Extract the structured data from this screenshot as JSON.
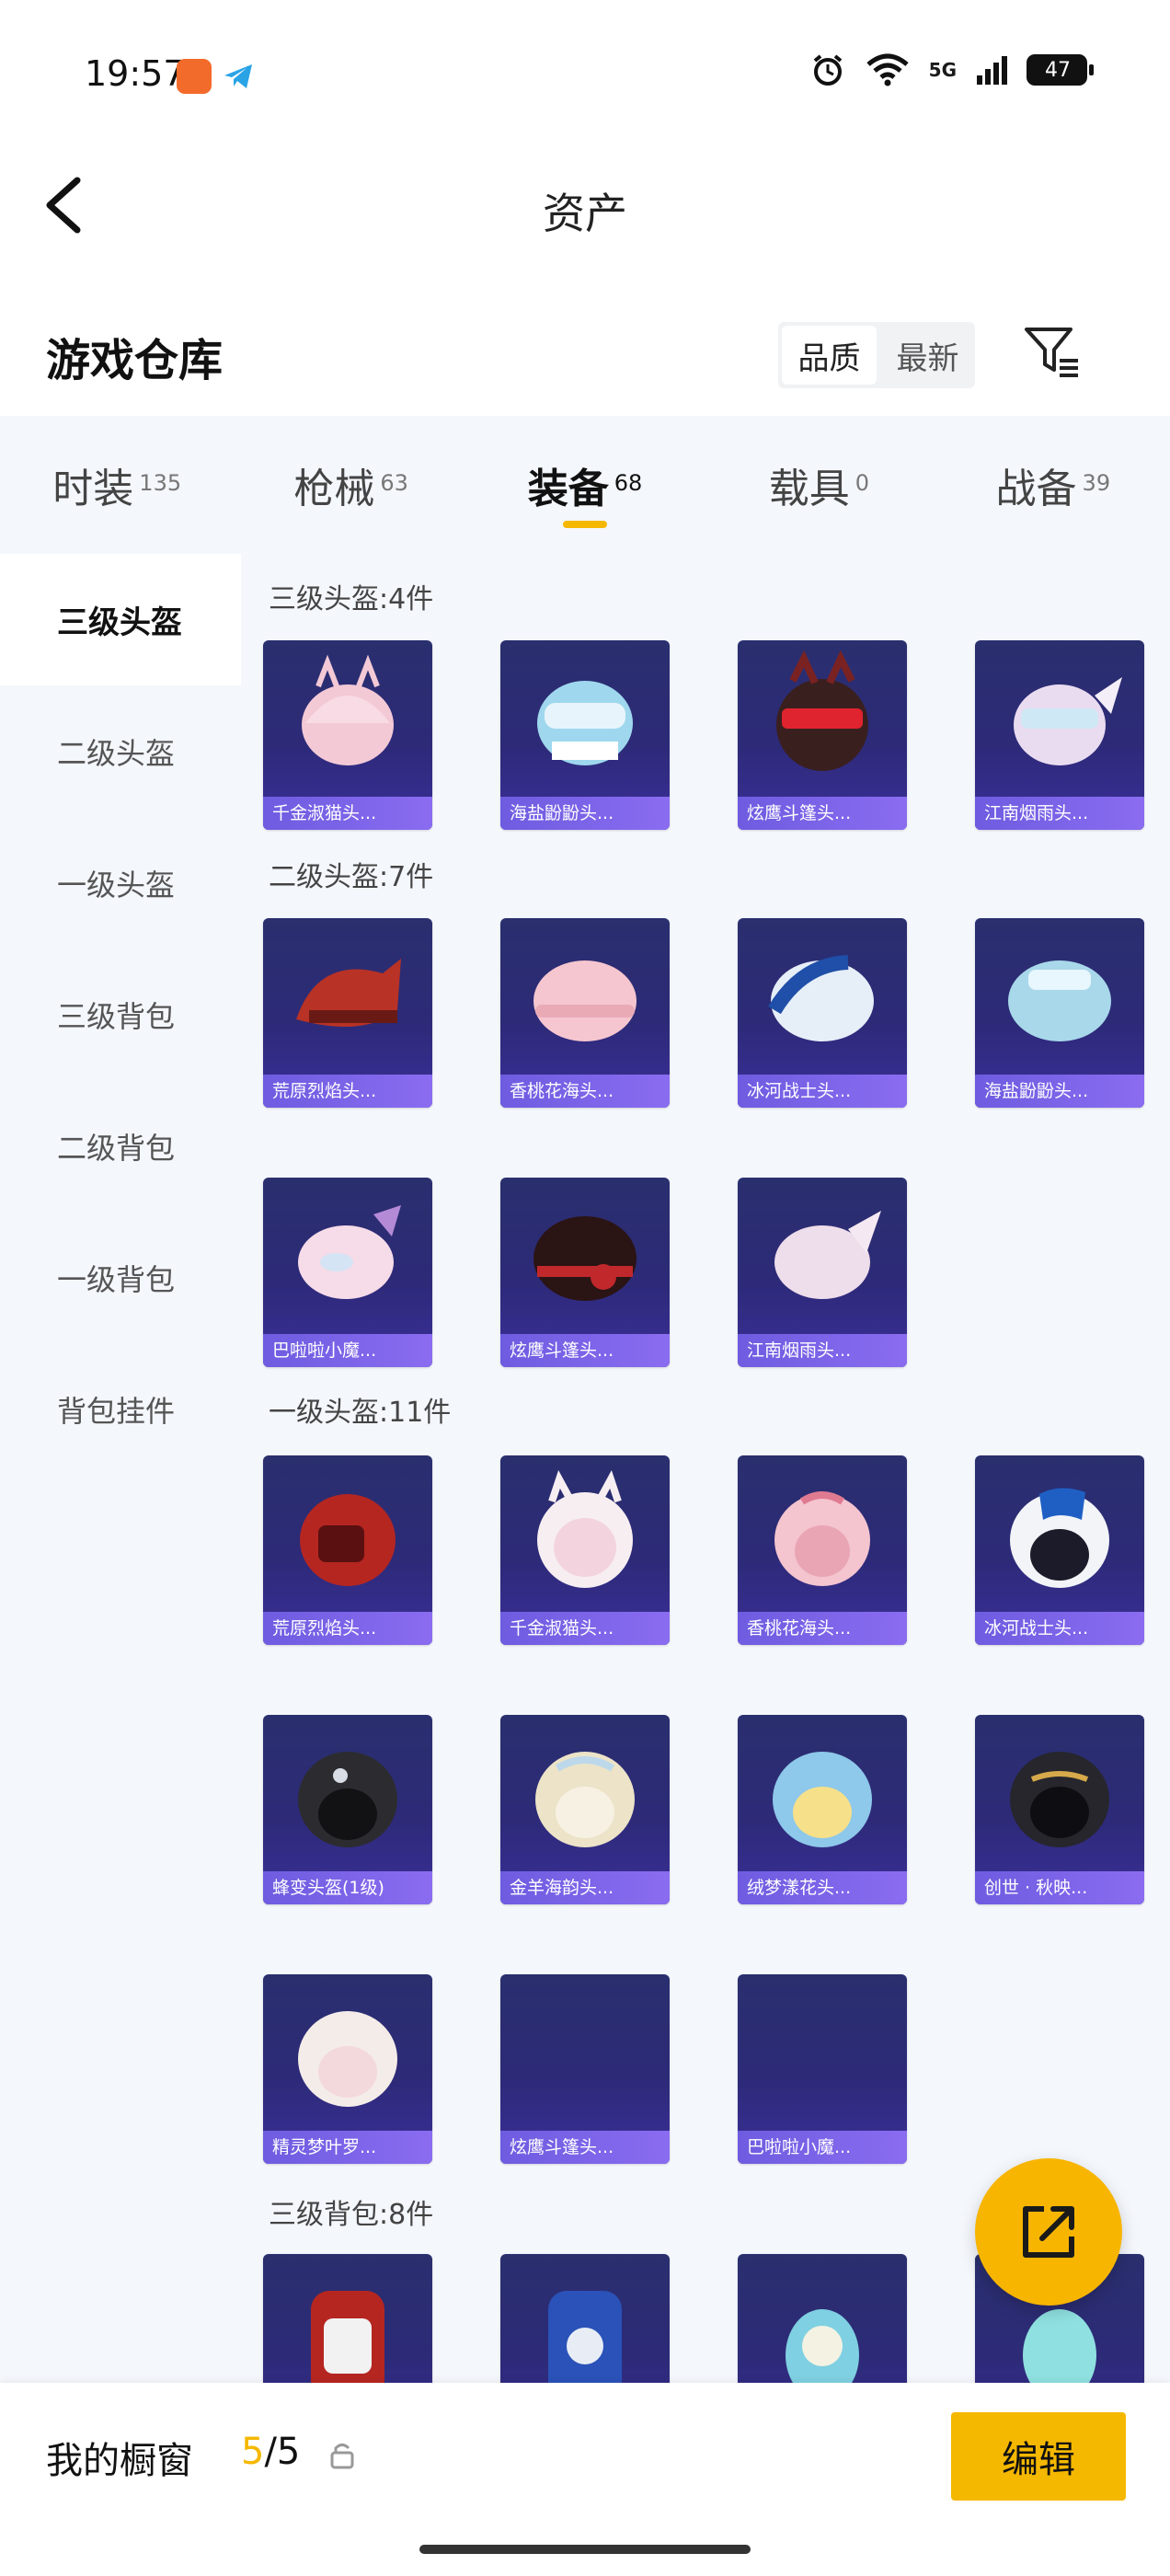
{
  "status_bar": {
    "time": "19:57",
    "network": "5G",
    "battery": "47"
  },
  "header": {
    "title": "资产"
  },
  "warehouse": {
    "title": "游戏仓库",
    "sort_options": [
      "品质",
      "最新"
    ]
  },
  "tabs": [
    {
      "label": "时装",
      "count": "135"
    },
    {
      "label": "枪械",
      "count": "63"
    },
    {
      "label": "装备",
      "count": "68"
    },
    {
      "label": "载具",
      "count": "0"
    },
    {
      "label": "战备",
      "count": "39"
    }
  ],
  "sidebar": {
    "items": [
      "三级头盔",
      "二级头盔",
      "一级头盔",
      "三级背包",
      "二级背包",
      "一级背包",
      "背包挂件"
    ]
  },
  "sections": [
    {
      "title": "三级头盔:4件",
      "items": [
        "千金淑猫头...",
        "海盐鼢鼢头...",
        "炫鹰斗篷头...",
        "江南烟雨头..."
      ]
    },
    {
      "title": "二级头盔:7件",
      "items": [
        "荒原烈焰头...",
        "香桃花海头...",
        "冰河战士头...",
        "海盐鼢鼢头...",
        "巴啦啦小魔...",
        "炫鹰斗篷头...",
        "江南烟雨头..."
      ]
    },
    {
      "title": "一级头盔:11件",
      "items": [
        "荒原烈焰头...",
        "千金淑猫头...",
        "香桃花海头...",
        "冰河战士头...",
        "蜂变头盔(1级)",
        "金羊海韵头...",
        "绒梦漾花头...",
        "创世 · 秋映...",
        "精灵梦叶罗...",
        "炫鹰斗篷头...",
        "巴啦啦小魔..."
      ]
    },
    {
      "title": "三级背包:8件",
      "items": [
        "",
        "",
        "",
        ""
      ]
    }
  ],
  "bottom_bar": {
    "showcase_label": "我的橱窗",
    "showcase_current": "5",
    "showcase_total": "/5",
    "edit_label": "编辑"
  },
  "colors": {
    "accent": "#f5b800",
    "card_bg": "#2d2a78",
    "caption_bg": "#7a64e8",
    "panel_bg": "#f4f7fc"
  }
}
